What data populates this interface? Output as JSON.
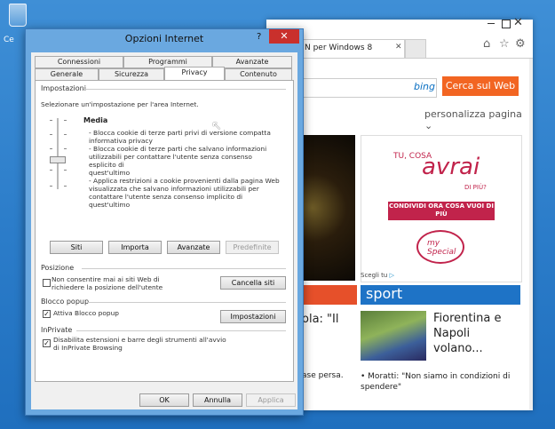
{
  "desktop": {
    "icon_label": "Ce"
  },
  "browser": {
    "tab_title": "N per Windows 8",
    "search_button": "Cerca sul Web",
    "search_brand": "bing",
    "personalize": "personalizza pagina",
    "ad": {
      "tu": "TU, COSA",
      "avrai": "avrai",
      "di_piu": "DI PIÙ?",
      "cta": "CONDIVIDI ORA COSA VUOI DI PIÙ",
      "logo": "my Special"
    },
    "scegli": "Scegli tu",
    "sport_label": "sport",
    "headline_left": "ola: \"Il",
    "headline_right": "Fiorentina e Napoli volano...",
    "caption_left": "ase persa.",
    "caption_right": "Moratti: \"Non siamo in condizioni di spendere\""
  },
  "dialog": {
    "title": "Opzioni Internet",
    "help": "?",
    "close": "✕",
    "tabs_top": [
      "Connessioni",
      "Programmi",
      "Avanzate"
    ],
    "tabs_bottom": [
      "Generale",
      "Sicurezza",
      "Privacy",
      "Contenuto"
    ],
    "active_tab": "Privacy",
    "settings_header": "Impostazioni",
    "settings_prompt": "Selezionare un'impostazione per l'area Internet.",
    "level": "Media",
    "level_lines": [
      "- Blocca cookie di terze parti privi di versione compatta",
      "informativa privacy",
      "- Blocca cookie di terze parti che salvano informazioni",
      "utilizzabili per contattare l'utente senza consenso esplicito di",
      "quest'ultimo",
      "- Applica restrizioni a cookie provenienti dalla pagina Web",
      "visualizzata che salvano informazioni utilizzabili per",
      "contattare l'utente senza consenso implicito di quest'ultimo"
    ],
    "buttons_row": [
      "Siti",
      "Importa",
      "Avanzate",
      "Predefinite"
    ],
    "position_header": "Posizione",
    "position_check": "Non consentire mai ai siti Web di richiedere la posizione dell'utente",
    "position_check_checked": false,
    "clear_sites": "Cancella siti",
    "popup_header": "Blocco popup",
    "popup_check": "Attiva Blocco popup",
    "popup_check_checked": true,
    "popup_settings": "Impostazioni",
    "inprivate_header": "InPrivate",
    "inprivate_check": "Disabilita estensioni e barre degli strumenti all'avvio di InPrivate Browsing",
    "inprivate_check_checked": true,
    "ok": "OK",
    "cancel": "Annulla",
    "apply": "Applica"
  }
}
